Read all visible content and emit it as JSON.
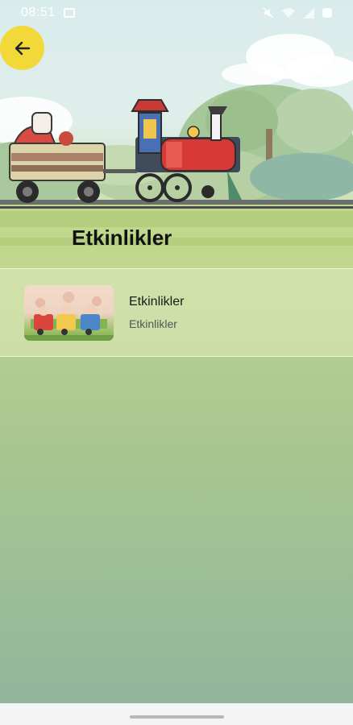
{
  "status_bar": {
    "time": "08:51",
    "left_icons": [
      "image-icon"
    ],
    "right_icons": [
      "mute-icon",
      "wifi-icon",
      "signal-icon",
      "battery-icon"
    ]
  },
  "header": {
    "back_icon": "arrow-left-icon",
    "title": "Etkinlikler",
    "accent_color": "#f2d838"
  },
  "list": {
    "items": [
      {
        "title": "Etkinlikler",
        "subtitle": "Etkinlikler",
        "thumbnail": "children-on-train-illustration"
      }
    ]
  }
}
